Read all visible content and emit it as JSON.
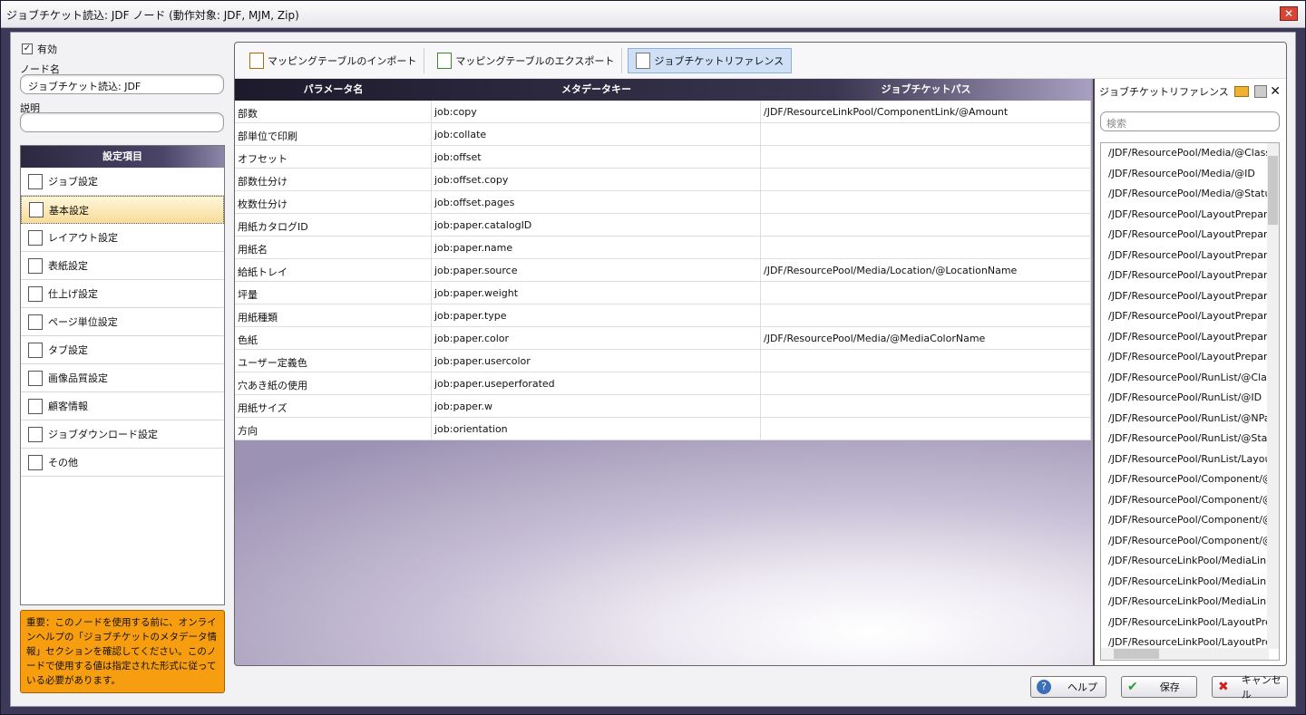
{
  "window": {
    "title": "ジョブチケット読込: JDF ノード (動作対象: JDF, MJM, Zip)",
    "close_icon": "close-icon"
  },
  "left": {
    "enabled_label": "有効",
    "enabled_checked": true,
    "node_name_label": "ノード名",
    "node_name_value": "ジョブチケット読込: JDF",
    "description_label": "説明",
    "description_value": "",
    "settings_header": "設定項目",
    "items": [
      {
        "label": "ジョブ設定",
        "icon": "document-icon"
      },
      {
        "label": "基本設定",
        "icon": "list-icon",
        "selected": true
      },
      {
        "label": "レイアウト設定",
        "icon": "layout-icon"
      },
      {
        "label": "表紙設定",
        "icon": "cover-icon"
      },
      {
        "label": "仕上げ設定",
        "icon": "finishing-icon"
      },
      {
        "label": "ページ単位設定",
        "icon": "pages-icon"
      },
      {
        "label": "タブ設定",
        "icon": "tab-icon"
      },
      {
        "label": "画像品質設定",
        "icon": "image-icon"
      },
      {
        "label": "顧客情報",
        "icon": "customer-icon"
      },
      {
        "label": "ジョブダウンロード設定",
        "icon": "download-icon"
      },
      {
        "label": "その他",
        "icon": "other-icon"
      }
    ],
    "note": "重要：このノードを使用する前に、オンラインヘルプの「ジョブチケットのメタデータ情報」セクションを確認してください。このノードで使用する値は指定された形式に従っている必要があります。"
  },
  "toolbar": {
    "import_label": "マッピングテーブルのインポート",
    "export_label": "マッピングテーブルのエクスポート",
    "reference_label": "ジョブチケットリファレンス"
  },
  "grid": {
    "columns": [
      "パラメータ名",
      "メタデータキー",
      "ジョブチケットパス"
    ],
    "rows": [
      [
        "部数",
        "job:copy",
        "/JDF/ResourceLinkPool/ComponentLink/@Amount"
      ],
      [
        "部単位で印刷",
        "job:collate",
        ""
      ],
      [
        "オフセット",
        "job:offset",
        ""
      ],
      [
        "部数仕分け",
        "job:offset.copy",
        ""
      ],
      [
        "枚数仕分け",
        "job:offset.pages",
        ""
      ],
      [
        "用紙カタログID",
        "job:paper.catalogID",
        ""
      ],
      [
        "用紙名",
        "job:paper.name",
        ""
      ],
      [
        "給紙トレイ",
        "job:paper.source",
        "/JDF/ResourcePool/Media/Location/@LocationName"
      ],
      [
        "坪量",
        "job:paper.weight",
        ""
      ],
      [
        "用紙種類",
        "job:paper.type",
        ""
      ],
      [
        "色紙",
        "job:paper.color",
        "/JDF/ResourcePool/Media/@MediaColorName"
      ],
      [
        "ユーザー定義色",
        "job:paper.usercolor",
        ""
      ],
      [
        "穴あき紙の使用",
        "job:paper.useperforated",
        ""
      ],
      [
        "用紙サイズ",
        "job:paper.w",
        ""
      ],
      [
        "方向",
        "job:orientation",
        ""
      ]
    ]
  },
  "reference": {
    "title": "ジョブチケットリファレンス",
    "search_placeholder": "検索",
    "items": [
      "/JDF/ResourcePool/Media/@Class",
      "/JDF/ResourcePool/Media/@ID",
      "/JDF/ResourcePool/Media/@Statu",
      "/JDF/ResourcePool/LayoutPrepara",
      "/JDF/ResourcePool/LayoutPrepara",
      "/JDF/ResourcePool/LayoutPrepara",
      "/JDF/ResourcePool/LayoutPrepara",
      "/JDF/ResourcePool/LayoutPrepara",
      "/JDF/ResourcePool/LayoutPrepara",
      "/JDF/ResourcePool/LayoutPrepara",
      "/JDF/ResourcePool/LayoutPrepara",
      "/JDF/ResourcePool/RunList/@Clas",
      "/JDF/ResourcePool/RunList/@ID",
      "/JDF/ResourcePool/RunList/@NPa",
      "/JDF/ResourcePool/RunList/@Stat",
      "/JDF/ResourcePool/RunList/Layou",
      "/JDF/ResourcePool/Component/@",
      "/JDF/ResourcePool/Component/@",
      "/JDF/ResourcePool/Component/@",
      "/JDF/ResourcePool/Component/@",
      "/JDF/ResourceLinkPool/MediaLink",
      "/JDF/ResourceLinkPool/MediaLink",
      "/JDF/ResourceLinkPool/MediaLink",
      "/JDF/ResourceLinkPool/LayoutPre",
      "/JDF/ResourceLinkPool/LayoutPre"
    ]
  },
  "buttons": {
    "help": "ヘルプ",
    "save": "保存",
    "cancel": "キャンセル"
  }
}
